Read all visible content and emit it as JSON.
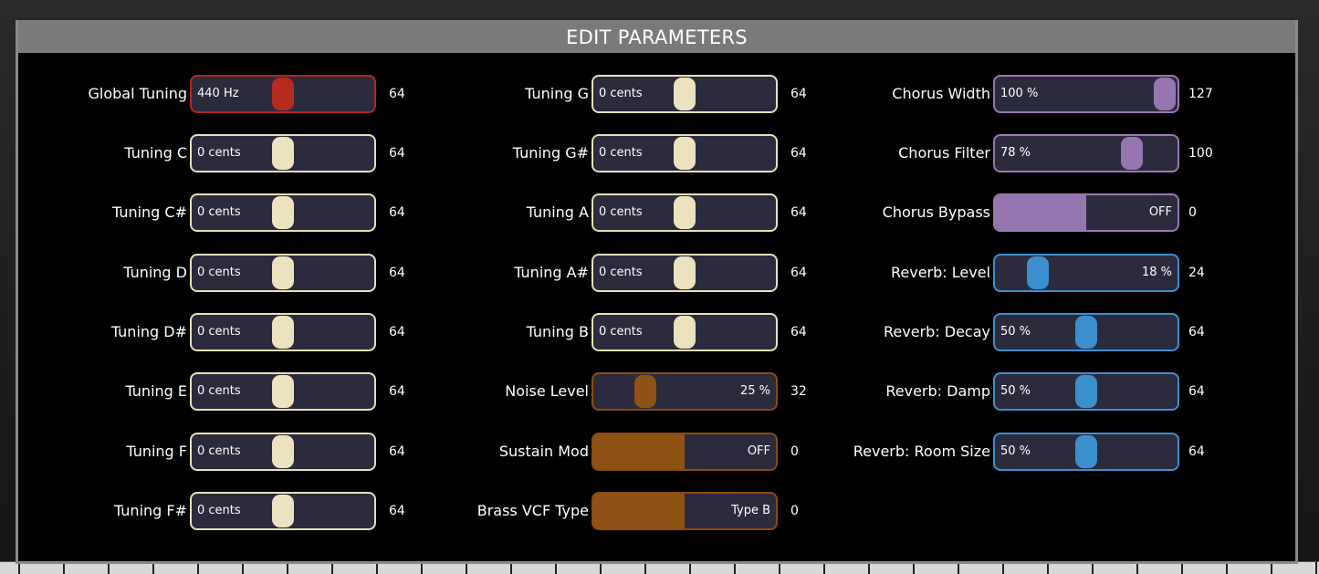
{
  "window": {
    "title": "EDIT PARAMETERS"
  },
  "params": {
    "global_tuning": {
      "label": "Global Tuning",
      "display": "440 Hz",
      "value": "64",
      "level": 0.5
    },
    "tuning_c": {
      "label": "Tuning C",
      "display": "0 cents",
      "value": "64",
      "level": 0.5
    },
    "tuning_cs": {
      "label": "Tuning C#",
      "display": "0 cents",
      "value": "64",
      "level": 0.5
    },
    "tuning_d": {
      "label": "Tuning D",
      "display": "0 cents",
      "value": "64",
      "level": 0.5
    },
    "tuning_ds": {
      "label": "Tuning D#",
      "display": "0 cents",
      "value": "64",
      "level": 0.5
    },
    "tuning_e": {
      "label": "Tuning E",
      "display": "0 cents",
      "value": "64",
      "level": 0.5
    },
    "tuning_f": {
      "label": "Tuning F",
      "display": "0 cents",
      "value": "64",
      "level": 0.5
    },
    "tuning_fs": {
      "label": "Tuning F#",
      "display": "0 cents",
      "value": "64",
      "level": 0.5
    },
    "tuning_g": {
      "label": "Tuning G",
      "display": "0 cents",
      "value": "64",
      "level": 0.5
    },
    "tuning_gs": {
      "label": "Tuning G#",
      "display": "0 cents",
      "value": "64",
      "level": 0.5
    },
    "tuning_a": {
      "label": "Tuning A",
      "display": "0 cents",
      "value": "64",
      "level": 0.5
    },
    "tuning_as": {
      "label": "Tuning A#",
      "display": "0 cents",
      "value": "64",
      "level": 0.5
    },
    "tuning_b": {
      "label": "Tuning B",
      "display": "0 cents",
      "value": "64",
      "level": 0.5
    },
    "noise_level": {
      "label": "Noise Level",
      "display": "25 %",
      "value": "32",
      "level": 0.25
    },
    "sustain_mod": {
      "label": "Sustain Mod",
      "display": "OFF",
      "value": "0",
      "level": 0.5
    },
    "brass_vcf_type": {
      "label": "Brass VCF Type",
      "display": "Type B",
      "value": "0",
      "level": 0.5
    },
    "chorus_width": {
      "label": "Chorus Width",
      "display": "100 %",
      "value": "127",
      "level": 1.0
    },
    "chorus_filter": {
      "label": "Chorus Filter",
      "display": "78 %",
      "value": "100",
      "level": 0.79
    },
    "chorus_bypass": {
      "label": "Chorus Bypass",
      "display": "OFF",
      "value": "0",
      "level": 0.5
    },
    "reverb_level": {
      "label": "Reverb: Level",
      "display": "18 %",
      "value": "24",
      "level": 0.19
    },
    "reverb_decay": {
      "label": "Reverb: Decay",
      "display": "50 %",
      "value": "64",
      "level": 0.5
    },
    "reverb_damp": {
      "label": "Reverb: Damp",
      "display": "50 %",
      "value": "64",
      "level": 0.5
    },
    "reverb_room": {
      "label": "Reverb: Room Size",
      "display": "50 %",
      "value": "64",
      "level": 0.5
    }
  },
  "colors": {
    "tuning": "#ede2bf",
    "global_tuning": "#b52b1d",
    "misc": "#8e5215",
    "chorus": "#9676af",
    "reverb": "#3b8fcd"
  }
}
